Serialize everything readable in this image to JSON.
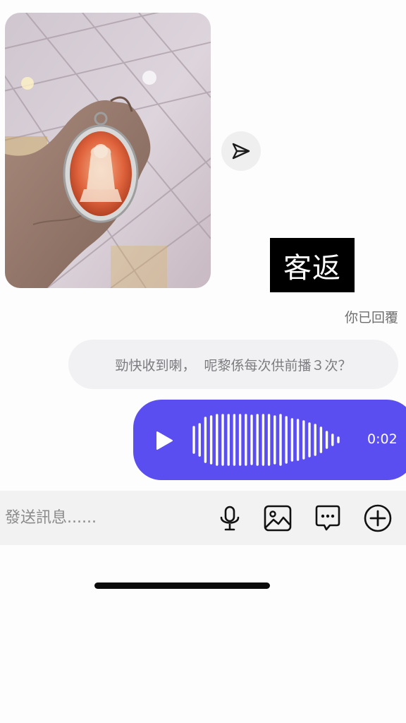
{
  "photo_message": {
    "image": "amulet-in-hand-photo"
  },
  "share_button": {
    "icon": "send-icon"
  },
  "overlay_tag": {
    "text": "客返"
  },
  "reply_label": "你已回覆",
  "quoted_message": {
    "text": "勁快收到喇，  呢黎係每次供前播３次？"
  },
  "voice_message": {
    "duration": "0:02",
    "play_icon": "play-icon",
    "bubble_color": "#5b4ef0"
  },
  "composer": {
    "placeholder": "發送訊息......",
    "icons": [
      "microphone-icon",
      "image-icon",
      "chat-bubble-icon",
      "add-circle-icon"
    ]
  }
}
